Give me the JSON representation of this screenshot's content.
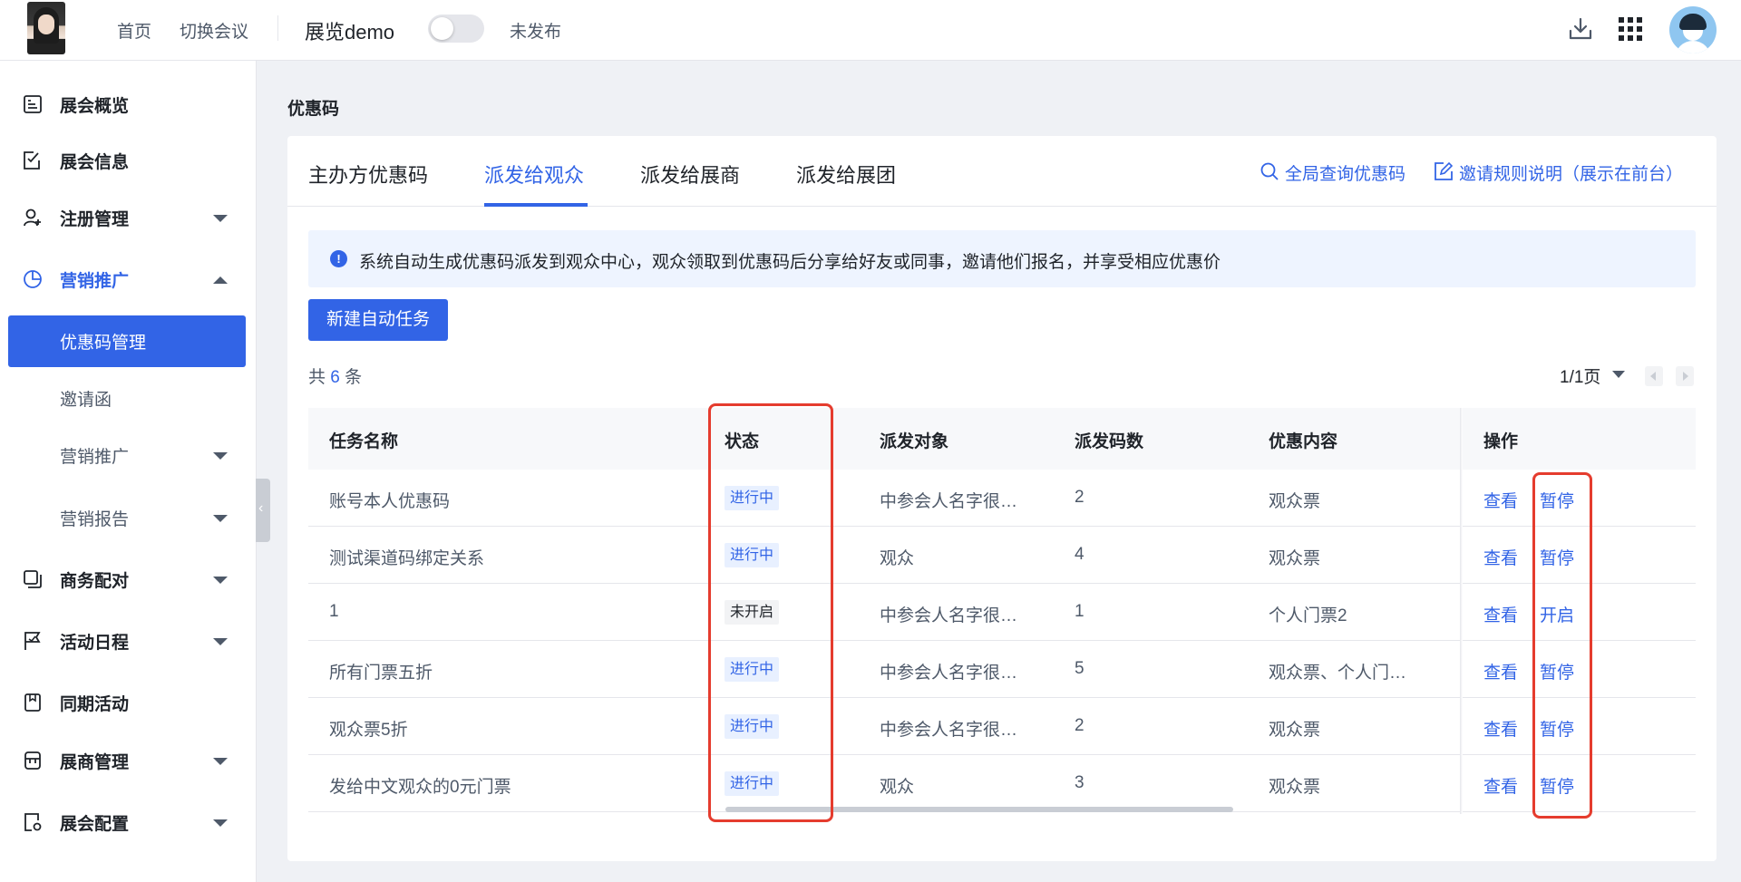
{
  "header": {
    "nav_home": "首页",
    "nav_switch": "切换会议",
    "title": "展览demo",
    "publish_status": "未发布",
    "download_icon": "download-icon",
    "apps_icon": "apps-grid-icon"
  },
  "sidebar": {
    "items": [
      {
        "label": "展会概览",
        "icon": "overview-icon"
      },
      {
        "label": "展会信息",
        "icon": "info-icon"
      },
      {
        "label": "注册管理",
        "icon": "user-add-icon"
      },
      {
        "label": "营销推广",
        "icon": "pie-chart-icon"
      },
      {
        "label": "优惠码管理"
      },
      {
        "label": "邀请函"
      },
      {
        "label": "营销推广"
      },
      {
        "label": "营销报告"
      },
      {
        "label": "商务配对",
        "icon": "copy-icon"
      },
      {
        "label": "活动日程",
        "icon": "flag-icon"
      },
      {
        "label": "同期活动",
        "icon": "bookmark-icon"
      },
      {
        "label": "展商管理",
        "icon": "store-icon"
      },
      {
        "label": "展会配置",
        "icon": "settings-doc-icon"
      }
    ]
  },
  "page": {
    "title": "优惠码",
    "tabs": [
      "主办方优惠码",
      "派发给观众",
      "派发给展商",
      "派发给展团"
    ],
    "active_tab": "派发给观众",
    "action_search": "全局查询优惠码",
    "action_rules": "邀请规则说明（展示在前台）",
    "notice": "系统自动生成优惠码派发到观众中心，观众领取到优惠码后分享给好友或同事，邀请他们报名，并享受相应优惠价",
    "new_task_button": "新建自动任务",
    "total_prefix": "共",
    "total_count": "6",
    "total_suffix": "条",
    "pager": "1/1页"
  },
  "table": {
    "columns": [
      "任务名称",
      "状态",
      "派发对象",
      "派发码数",
      "优惠内容",
      "操作"
    ],
    "rows": [
      {
        "name": "账号本人优惠码",
        "status": "进行中",
        "target": "中参会人名字很…",
        "count": "2",
        "content": "观众票",
        "view": "查看",
        "action": "暂停"
      },
      {
        "name": "测试渠道码绑定关系",
        "status": "进行中",
        "target": "观众",
        "count": "4",
        "content": "观众票",
        "view": "查看",
        "action": "暂停"
      },
      {
        "name": "1",
        "status": "未开启",
        "target": "中参会人名字很…",
        "count": "1",
        "content": "个人门票2",
        "view": "查看",
        "action": "开启"
      },
      {
        "name": "所有门票五折",
        "status": "进行中",
        "target": "中参会人名字很…",
        "count": "5",
        "content": "观众票、个人门…",
        "view": "查看",
        "action": "暂停"
      },
      {
        "name": "观众票5折",
        "status": "进行中",
        "target": "中参会人名字很…",
        "count": "2",
        "content": "观众票",
        "view": "查看",
        "action": "暂停"
      },
      {
        "name": "发给中文观众的0元门票",
        "status": "进行中",
        "target": "观众",
        "count": "3",
        "content": "观众票",
        "view": "查看",
        "action": "暂停"
      }
    ]
  },
  "colors": {
    "accent": "#3264e6",
    "highlight": "#e53c2e"
  }
}
